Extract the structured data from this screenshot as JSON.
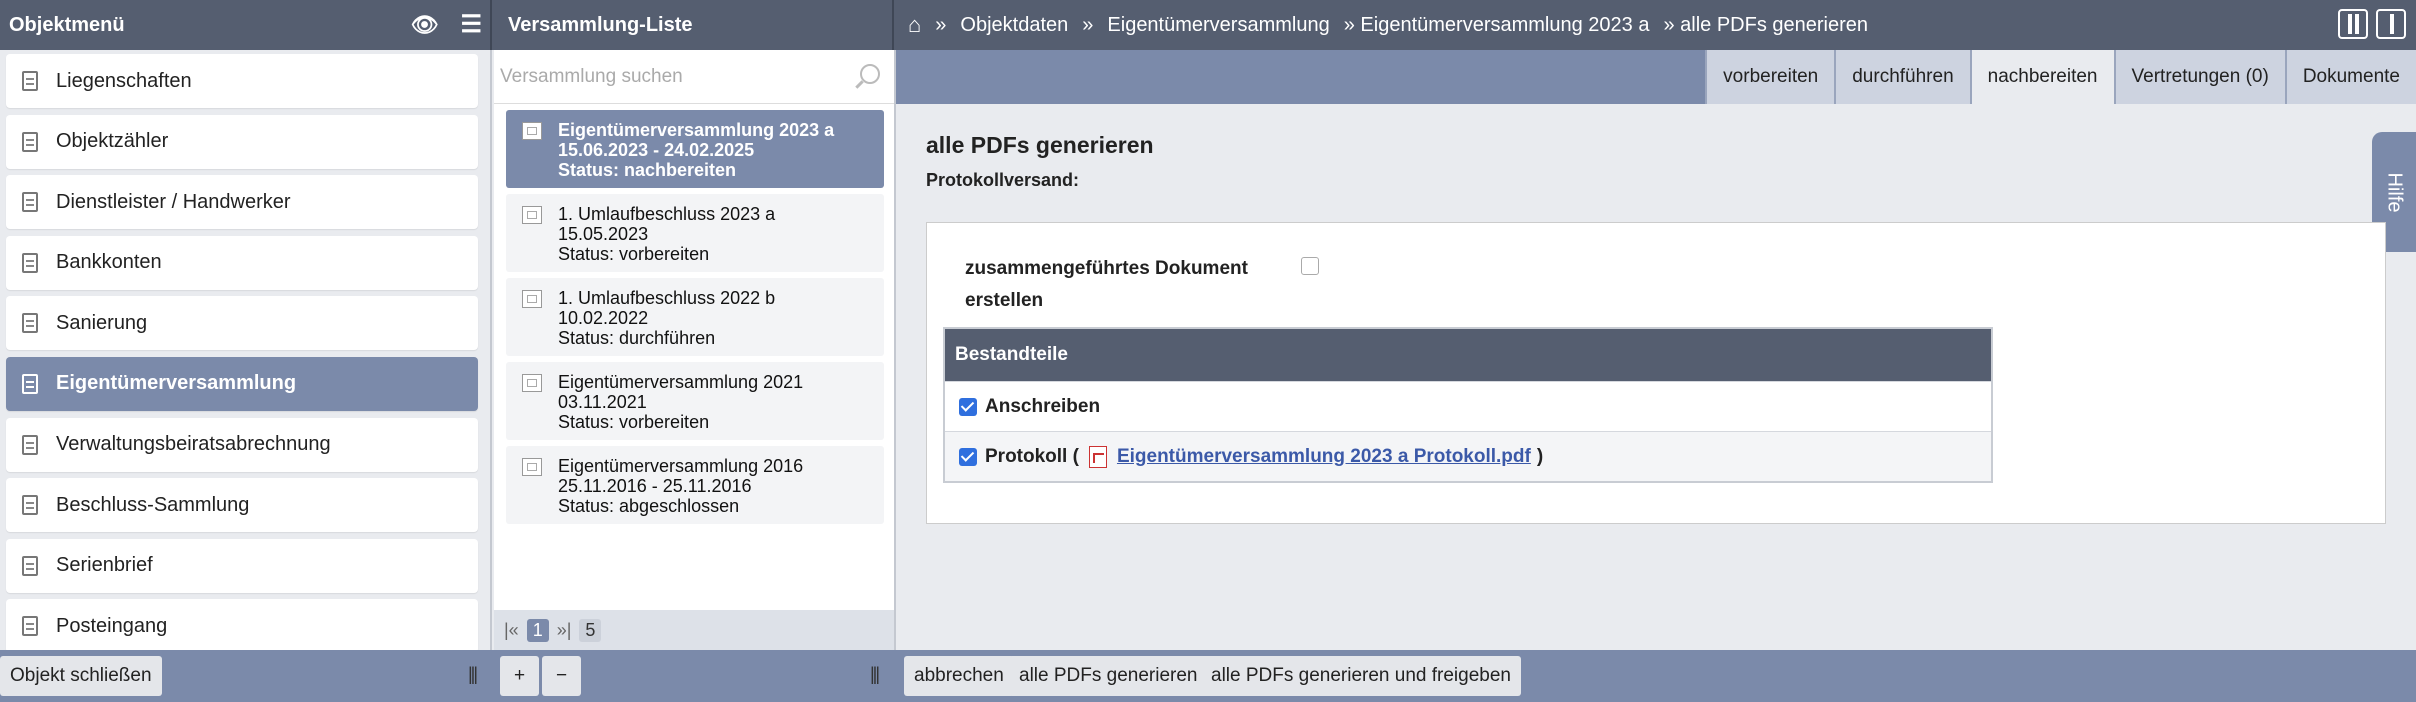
{
  "header": {
    "menu_title": "Objektmenü",
    "list_title": "Versammlung-Liste",
    "breadcrumb": [
      "»",
      "Objektdaten",
      "»",
      "Eigentümerversammlung",
      "» Eigentümerversammlung 2023 a",
      "» alle PDFs generieren"
    ]
  },
  "sidebar": {
    "items": [
      {
        "label": "Liegenschaften"
      },
      {
        "label": "Objektzähler"
      },
      {
        "label": "Dienstleister / Handwerker"
      },
      {
        "label": "Bankkonten"
      },
      {
        "label": "Sanierung"
      },
      {
        "label": "Eigentümerversammlung"
      },
      {
        "label": "Verwaltungsbeiratsabrechnung"
      },
      {
        "label": "Beschluss-Sammlung"
      },
      {
        "label": "Serienbrief"
      },
      {
        "label": "Posteingang"
      }
    ],
    "active_index": 5
  },
  "list": {
    "search_placeholder": "Versammlung suchen",
    "entries": [
      {
        "title": "Eigentümerversammlung 2023 a",
        "date": "15.06.2023 - 24.02.2025",
        "status": "Status: nachbereiten"
      },
      {
        "title": "1. Umlaufbeschluss 2023 a",
        "date": "15.05.2023",
        "status": "Status: vorbereiten"
      },
      {
        "title": "1. Umlaufbeschluss 2022 b",
        "date": "10.02.2022",
        "status": "Status: durchführen"
      },
      {
        "title": "Eigentümerversammlung 2021",
        "date": "03.11.2021",
        "status": "Status: vorbereiten"
      },
      {
        "title": "Eigentümerversammlung 2016",
        "date": "25.11.2016 - 25.11.2016",
        "status": "Status: abgeschlossen"
      }
    ],
    "pager": {
      "first": "|«",
      "current": "1",
      "next": "»|",
      "total": "5"
    }
  },
  "tabs": [
    {
      "label": "vorbereiten"
    },
    {
      "label": "durchführen"
    },
    {
      "label": "nachbereiten"
    },
    {
      "label": "Vertretungen (0)"
    },
    {
      "label": "Dokumente"
    }
  ],
  "main": {
    "title": "alle PDFs generieren",
    "subtitle": "Protokollversand:",
    "merged_label": "zusammengeführtes Dokument erstellen",
    "help": "Hilfe",
    "table": {
      "header": "Bestandteile",
      "row1": "Anschreiben",
      "row2_prefix": "Protokoll (",
      "row2_link": "Eigentümerversammlung 2023 a Protokoll.pdf",
      "row2_suffix": ")"
    }
  },
  "footer": {
    "close_object": "Objekt schließen",
    "add": "+",
    "remove": "−",
    "cancel": "abbrechen",
    "generate": "alle PDFs generieren",
    "generate_release": "alle PDFs generieren und freigeben"
  }
}
